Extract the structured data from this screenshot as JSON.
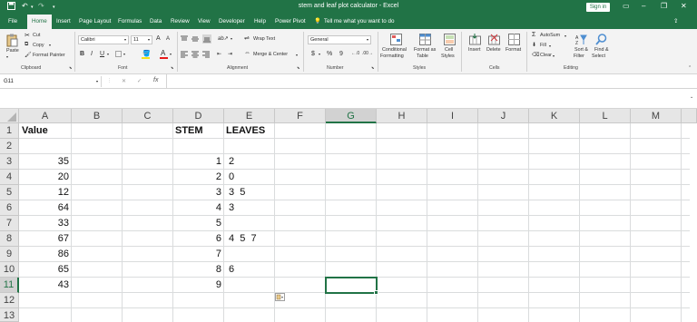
{
  "title_bar": {
    "document_title": "stem and leaf plot calculator  -  Excel",
    "sign_in_label": "Sign in",
    "quick_access": [
      "save-icon",
      "undo-icon",
      "redo-icon",
      "customize-icon"
    ],
    "window_controls": [
      "ribbon-display-icon",
      "minimize-icon",
      "restore-icon",
      "close-icon"
    ]
  },
  "tabs": [
    "File",
    "Home",
    "Insert",
    "Page Layout",
    "Formulas",
    "Data",
    "Review",
    "View",
    "Developer",
    "Help",
    "Power Pivot"
  ],
  "active_tab": "Home",
  "tell_me": "Tell me what you want to do",
  "ribbon": {
    "clipboard": {
      "paste": "Paste",
      "cut": "Cut",
      "copy": "Copy",
      "format_painter": "Format Painter",
      "label": "Clipboard"
    },
    "font": {
      "font_name": "Calibri",
      "font_size": "11",
      "bold": "B",
      "italic": "I",
      "underline": "U",
      "grow": "A",
      "shrink": "A",
      "label": "Font"
    },
    "alignment": {
      "wrap_text": "Wrap Text",
      "merge_center": "Merge & Center",
      "label": "Alignment"
    },
    "number": {
      "format": "General",
      "currency": "$",
      "percent": "%",
      "comma": "9",
      "label": "Number"
    },
    "styles": {
      "conditional": [
        "Conditional",
        "Formatting"
      ],
      "format_table": [
        "Format as",
        "Table"
      ],
      "cell_styles": [
        "Cell",
        "Styles"
      ],
      "label": "Styles"
    },
    "cells": {
      "insert": "Insert",
      "delete": "Delete",
      "format": "Format",
      "label": "Cells"
    },
    "editing": {
      "autosum": "AutoSum",
      "fill": "Fill",
      "clear": "Clear",
      "sort_filter": [
        "Sort &",
        "Filter"
      ],
      "find_select": [
        "Find &",
        "Select"
      ],
      "label": "Editing"
    }
  },
  "formula_bar": {
    "name_box": "G11",
    "cancel": "✕",
    "enter": "✓",
    "fx": "fx",
    "formula": ""
  },
  "columns": [
    "A",
    "B",
    "C",
    "D",
    "E",
    "F",
    "G",
    "H",
    "I",
    "J",
    "K",
    "L",
    "M"
  ],
  "selected_column": "G",
  "rows": [
    "1",
    "2",
    "3",
    "4",
    "5",
    "6",
    "7",
    "8",
    "9",
    "10",
    "11",
    "12",
    "13"
  ],
  "selected_row": "11",
  "sheet": {
    "header_value": "Value",
    "header_stem": "STEM",
    "header_leaves": "LEAVES",
    "values": [
      "35",
      "20",
      "12",
      "64",
      "33",
      "67",
      "86",
      "65",
      "43"
    ],
    "stems": [
      "1",
      "2",
      "3",
      "4",
      "5",
      "6",
      "7",
      "8",
      "9"
    ],
    "leaves": [
      "2",
      "0",
      "3  5",
      "3",
      "",
      "4  5  7",
      "",
      "6",
      ""
    ]
  },
  "colors": {
    "accent": "#217346",
    "ribbon_bg": "#f3f3f3",
    "header_bg": "#e6e6e6"
  }
}
